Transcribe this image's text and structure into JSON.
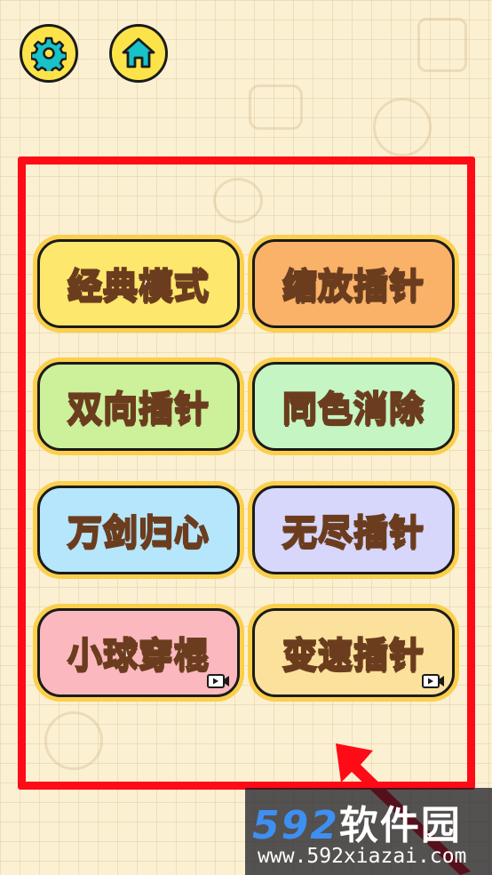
{
  "header": {
    "settings_icon": "gear-icon",
    "home_icon": "house-icon",
    "button_fill": "#fde34a"
  },
  "frame_color": "#ff0a17",
  "modes": [
    {
      "label": "经典模式",
      "color": "#fde76c",
      "video": false
    },
    {
      "label": "缩放插针",
      "color": "#f9b268",
      "video": false
    },
    {
      "label": "双向插针",
      "color": "#cdf09a",
      "video": false
    },
    {
      "label": "同色消除",
      "color": "#c5f5c2",
      "video": false
    },
    {
      "label": "万剑归心",
      "color": "#b5e6fb",
      "video": false
    },
    {
      "label": "无尽插针",
      "color": "#d7d6fb",
      "video": false
    },
    {
      "label": "小球穿棍",
      "color": "#fcb8bf",
      "video": true
    },
    {
      "label": "变速插针",
      "color": "#fbe19b",
      "video": true
    }
  ],
  "watermark": {
    "number": "592",
    "name": "软件园",
    "url": "www.592xiazai.com"
  }
}
